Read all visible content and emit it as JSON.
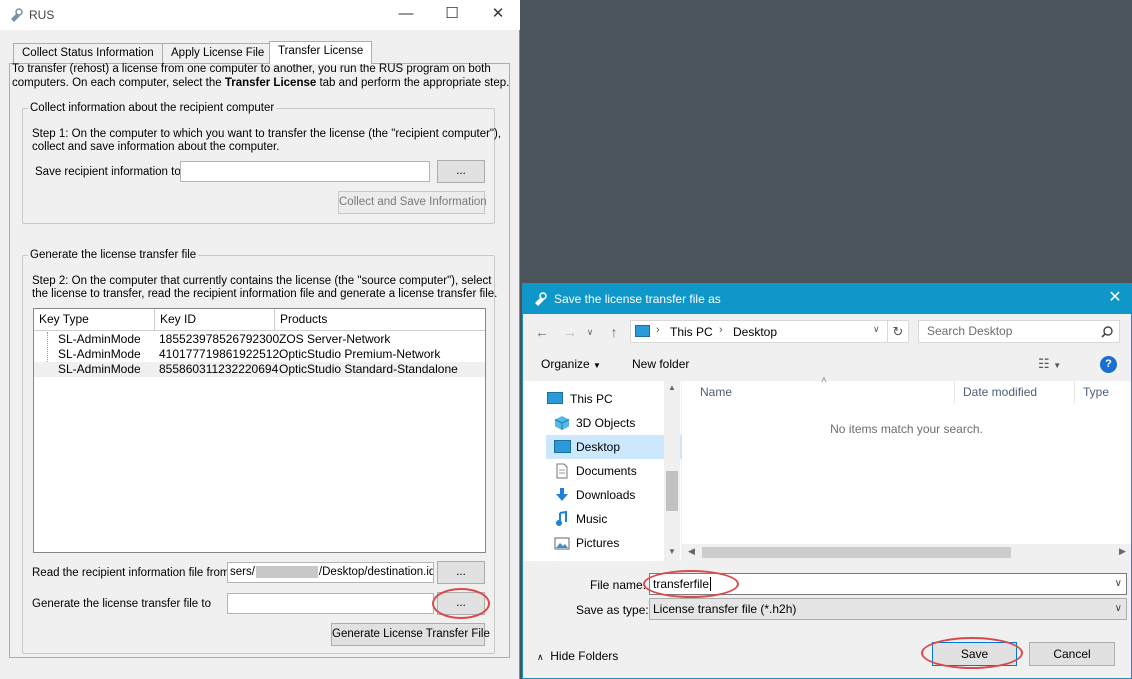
{
  "rus": {
    "title": "RUS",
    "tabs": [
      "Collect Status Information",
      "Apply License File",
      "Transfer License"
    ],
    "intro_line1": "To transfer (rehost) a license from one computer to another, you run the RUS program on both",
    "intro_line2_before": "computers. On each computer, select the ",
    "intro_line2_bold": "Transfer License",
    "intro_line2_after": " tab and perform the appropriate step.",
    "collect_group": {
      "title": "Collect information about the recipient computer",
      "step1_line1": "Step 1: On the computer to which you want to transfer the license (the \"recipient computer\"),",
      "step1_line2": "collect and save information about the computer.",
      "save_label": "Save recipient information to",
      "save_value": "",
      "browse_label": "...",
      "collect_button": "Collect and Save Information"
    },
    "generate_group": {
      "title": "Generate the license transfer file",
      "step2_line1": "Step 2: On the computer that currently contains the license (the \"source computer\"), select",
      "step2_line2": "the license to transfer, read the recipient information file and generate a license transfer file.",
      "columns": [
        "Key Type",
        "Key ID",
        "Products"
      ],
      "rows": [
        {
          "type": "SL-AdminMode",
          "id": "185523978526792300",
          "product": "ZOS Server-Network"
        },
        {
          "type": "SL-AdminMode",
          "id": "410177719861922512",
          "product": "OpticStudio Premium-Network"
        },
        {
          "type": "SL-AdminMode",
          "id": "855860311232220694",
          "product": "OpticStudio Standard-Standalone"
        }
      ],
      "read_label": "Read the recipient information file from",
      "read_value_prefix": "sers/",
      "read_value_suffix": "/Desktop/destination.id",
      "read_browse": "...",
      "gen_label": "Generate the license transfer file to",
      "gen_value": "",
      "gen_browse": "...",
      "gen_button": "Generate License Transfer File"
    }
  },
  "dialog": {
    "title": "Save the license transfer file as",
    "close": "✕",
    "path": [
      "This PC",
      "Desktop"
    ],
    "search_placeholder": "Search Desktop",
    "organize": "Organize",
    "new_folder": "New folder",
    "nav_items": [
      {
        "label": "This PC",
        "icon": "computer-icon"
      },
      {
        "label": "3D Objects",
        "icon": "cube-icon"
      },
      {
        "label": "Desktop",
        "icon": "desktop-icon"
      },
      {
        "label": "Documents",
        "icon": "document-icon"
      },
      {
        "label": "Downloads",
        "icon": "download-icon"
      },
      {
        "label": "Music",
        "icon": "music-icon"
      },
      {
        "label": "Pictures",
        "icon": "picture-icon"
      }
    ],
    "columns": [
      "Name",
      "Date modified",
      "Type"
    ],
    "empty_message": "No items match your search.",
    "file_name_label": "File name:",
    "file_name_value": "transferfile",
    "save_type_label": "Save as type:",
    "save_type_value": "License transfer file (*.h2h)",
    "hide_folders": "Hide Folders",
    "save_button": "Save",
    "cancel_button": "Cancel"
  },
  "colors": {
    "dialog_title_bar": "#0e97c8",
    "annotation": "#d94b4b",
    "selection": "#cce8ff"
  }
}
